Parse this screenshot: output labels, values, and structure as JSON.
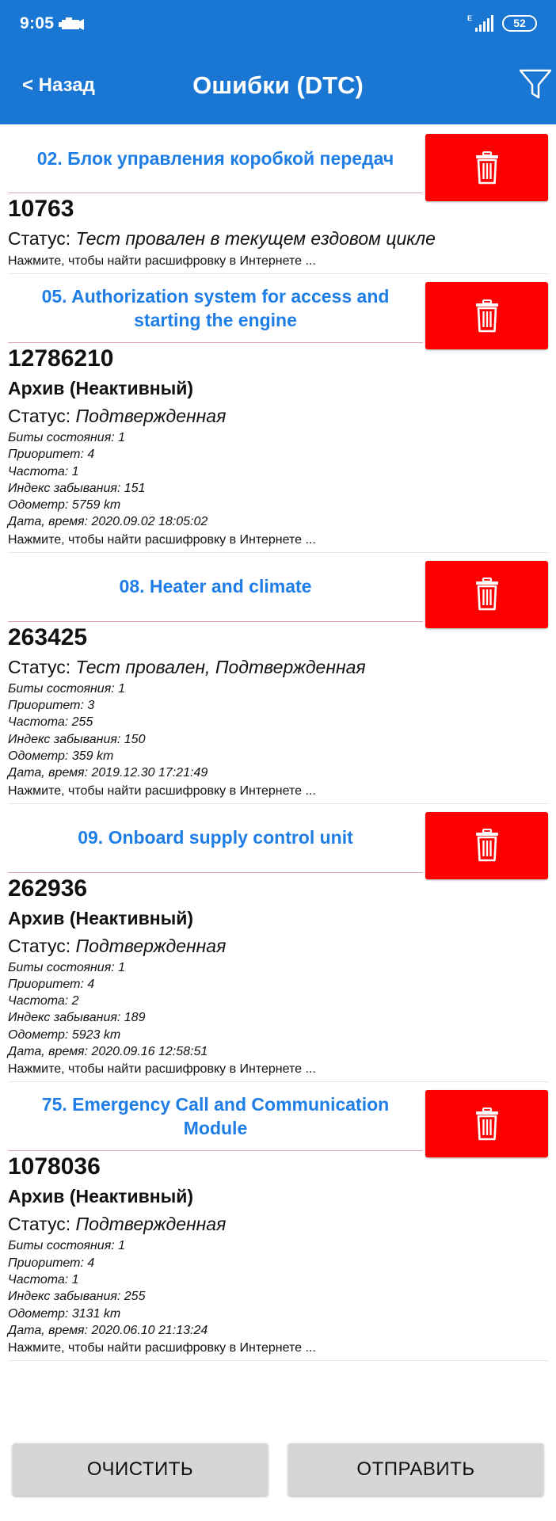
{
  "status_bar": {
    "time": "9:05",
    "network": "E",
    "battery": "52"
  },
  "header": {
    "back_label": "< Назад",
    "title": "Ошибки (DTC)"
  },
  "labels": {
    "status_prefix": "Статус: ",
    "hint": "Нажмите, чтобы найти расшифровку в Интернете ..."
  },
  "sections": [
    {
      "title": "02. Блок управления коробкой передач",
      "code": "10763",
      "status_value": "Тест провален в текущем ездовом цикле",
      "archive": null,
      "details": []
    },
    {
      "title": "05. Authorization system for access and starting the engine",
      "code": "12786210",
      "archive": "Архив (Неактивный)",
      "status_value": "Подтвержденная",
      "details": [
        "Биты состояния: 1",
        "Приоритет: 4",
        "Частота: 1",
        "Индекс забывания: 151",
        "Одометр: 5759 km",
        "Дата, время: 2020.09.02 18:05:02"
      ]
    },
    {
      "title": "08. Heater and climate",
      "code": "263425",
      "archive": null,
      "status_value": "Тест провален, Подтвержденная",
      "details": [
        "Биты состояния: 1",
        "Приоритет: 3",
        "Частота: 255",
        "Индекс забывания: 150",
        "Одометр: 359 km",
        "Дата, время: 2019.12.30 17:21:49"
      ]
    },
    {
      "title": "09. Onboard supply control unit",
      "code": "262936",
      "archive": "Архив (Неактивный)",
      "status_value": "Подтвержденная",
      "details": [
        "Биты состояния: 1",
        "Приоритет: 4",
        "Частота: 2",
        "Индекс забывания: 189",
        "Одометр: 5923 km",
        "Дата, время: 2020.09.16 12:58:51"
      ]
    },
    {
      "title": "75. Emergency Call and Communication Module",
      "code": "1078036",
      "archive": "Архив (Неактивный)",
      "status_value": "Подтвержденная",
      "details": [
        "Биты состояния: 1",
        "Приоритет: 4",
        "Частота: 1",
        "Индекс забывания: 255",
        "Одометр: 3131 km",
        "Дата, время: 2020.06.10 21:13:24"
      ]
    }
  ],
  "buttons": {
    "clear": "ОЧИСТИТЬ",
    "send": "ОТПРАВИТЬ"
  },
  "colors": {
    "appbar": "#1976d2",
    "section_title": "#1e7ee6",
    "delete_button": "#ff0000",
    "bottom_button": "#d6d6d6"
  },
  "icons": [
    "engine-icon",
    "signal-icon",
    "battery-icon",
    "filter-icon",
    "trash-icon"
  ]
}
